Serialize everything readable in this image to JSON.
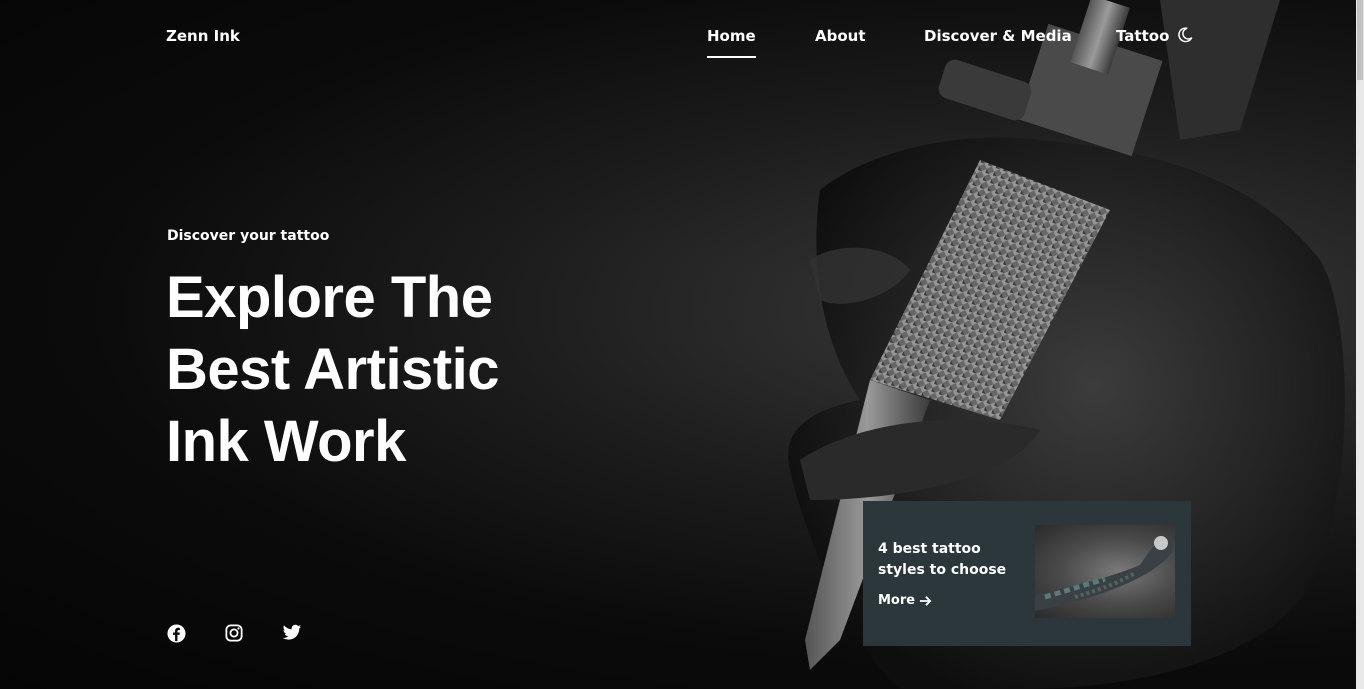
{
  "brand": {
    "name": "Zenn Ink"
  },
  "nav": {
    "items": [
      {
        "label": "Home",
        "active": true
      },
      {
        "label": "About",
        "active": false
      },
      {
        "label": "Discover & Media",
        "active": false
      },
      {
        "label": "Tattoo",
        "active": false
      }
    ],
    "theme_toggle_icon": "moon-icon"
  },
  "hero": {
    "kicker": "Discover your tattoo",
    "headline_lines": [
      "Explore The",
      "Best Artistic",
      "Ink Work"
    ]
  },
  "socials": [
    {
      "icon": "facebook-icon"
    },
    {
      "icon": "instagram-icon"
    },
    {
      "icon": "twitter-icon"
    }
  ],
  "card": {
    "title": "4 best tattoo styles to choose",
    "more_label": "More",
    "more_icon": "arrow-right-icon",
    "image_icon": "tattooed-arm-photo"
  },
  "colors": {
    "background": "#0a0a0a",
    "text": "#ffffff",
    "card_bg": "#2c373b"
  }
}
